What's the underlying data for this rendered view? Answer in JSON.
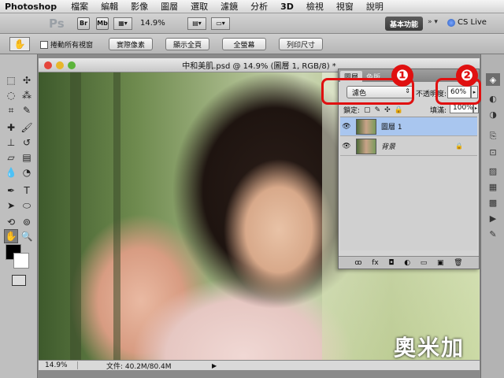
{
  "menubar": {
    "app": "Photoshop",
    "items": [
      "檔案",
      "編輯",
      "影像",
      "圖層",
      "選取",
      "濾鏡",
      "分析",
      "3D",
      "檢視",
      "視窗",
      "說明"
    ]
  },
  "appbar": {
    "logo": "Ps",
    "br": "Br",
    "mb": "Mb",
    "zoom": "14.9%",
    "workspace": "基本功能",
    "arrows": "»  ▾",
    "cslive": "CS Live"
  },
  "options": {
    "scroll_all": "捲動所有視窗",
    "btn_actual": "實際像素",
    "btn_fit": "顯示全頁",
    "btn_fill": "全螢幕",
    "btn_print": "列印尺寸"
  },
  "document": {
    "title": "中和美肌.psd @ 14.9% (圖層 1, RGB/8) *",
    "status_zoom": "14.9%",
    "status_file": "文件: 40.2M/80.4M"
  },
  "panel": {
    "tab_layers": "圖層",
    "tab_channels": "色版",
    "blend_mode": "濾色",
    "opacity_label": "不透明度:",
    "opacity_value": "60%",
    "lock_label": "鎖定:",
    "fill_label": "填滿:",
    "fill_value": "100%",
    "layers": [
      {
        "name": "圖層 1",
        "selected": true
      },
      {
        "name": "背景",
        "selected": false
      }
    ],
    "footer": [
      "ꝏ",
      "fx",
      "◘",
      "◐",
      "▭",
      "▣",
      "🗑"
    ]
  },
  "callouts": [
    "❶",
    "❷"
  ],
  "watermark": "奧米加",
  "colors": {
    "highlight_red": "#e01010",
    "layer_selected": "#a9c6ef"
  }
}
